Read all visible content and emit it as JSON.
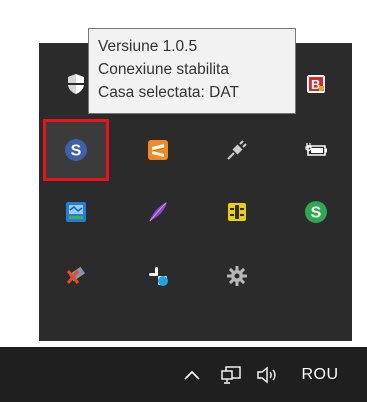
{
  "tooltip": {
    "line1": "Versiune 1.0.5",
    "line2": "Conexiune stabilita",
    "line3": "Casa selectata: DAT"
  },
  "tray_icons": [
    {
      "name": "shield-icon",
      "row": 1,
      "col": 1
    },
    {
      "name": "b-app-icon",
      "row": 1,
      "col": 4
    },
    {
      "name": "dollar-blue-icon",
      "row": 2,
      "col": 1,
      "selected": true
    },
    {
      "name": "sublime-text-icon",
      "row": 2,
      "col": 2
    },
    {
      "name": "plug-icon",
      "row": 2,
      "col": 3
    },
    {
      "name": "battery-charging-icon",
      "row": 2,
      "col": 4
    },
    {
      "name": "network-monitor-icon",
      "row": 3,
      "col": 1
    },
    {
      "name": "feather-icon",
      "row": 3,
      "col": 2
    },
    {
      "name": "sim-card-icon",
      "row": 3,
      "col": 3
    },
    {
      "name": "dollar-green-icon",
      "row": 3,
      "col": 4
    },
    {
      "name": "disconnected-drive-icon",
      "row": 4,
      "col": 1
    },
    {
      "name": "slack-icon",
      "row": 4,
      "col": 2
    },
    {
      "name": "gear-icon",
      "row": 4,
      "col": 3
    }
  ],
  "colors": {
    "flyout_bg": "#2b2b2b",
    "taskbar_bg": "#1f1f1f",
    "selection_outline": "#e8141c",
    "tooltip_bg": "#f2f2f2"
  },
  "taskbar": {
    "language": "ROU",
    "icons": [
      "chevron-up-icon",
      "network-icon",
      "volume-icon"
    ]
  }
}
